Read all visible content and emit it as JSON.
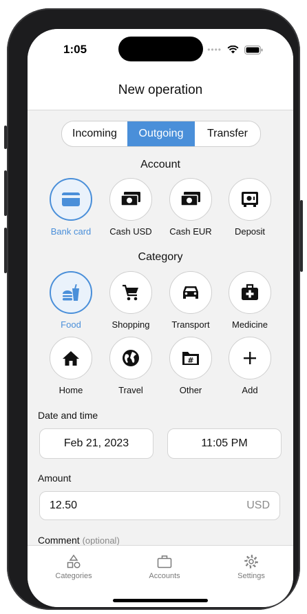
{
  "status": {
    "time": "1:05"
  },
  "nav": {
    "title": "New operation"
  },
  "type_tabs": [
    {
      "label": "Incoming"
    },
    {
      "label": "Outgoing"
    },
    {
      "label": "Transfer"
    }
  ],
  "selected_type": "Outgoing",
  "account": {
    "title": "Account",
    "items": [
      {
        "label": "Bank card",
        "icon": "credit-card-icon"
      },
      {
        "label": "Cash USD",
        "icon": "money-icon"
      },
      {
        "label": "Cash EUR",
        "icon": "money-icon"
      },
      {
        "label": "Deposit",
        "icon": "safe-icon"
      }
    ],
    "selected": "Bank card"
  },
  "category": {
    "title": "Category",
    "items": [
      {
        "label": "Food",
        "icon": "fastfood-icon"
      },
      {
        "label": "Shopping",
        "icon": "cart-icon"
      },
      {
        "label": "Transport",
        "icon": "car-icon"
      },
      {
        "label": "Medicine",
        "icon": "medical-bag-icon"
      },
      {
        "label": "Home",
        "icon": "home-icon"
      },
      {
        "label": "Travel",
        "icon": "globe-icon"
      },
      {
        "label": "Other",
        "icon": "folder-hash-icon"
      },
      {
        "label": "Add",
        "icon": "plus-icon"
      }
    ],
    "selected": "Food"
  },
  "datetime": {
    "label": "Date and time",
    "date": "Feb 21, 2023",
    "time": "11:05 PM"
  },
  "amount": {
    "label": "Amount",
    "value": "12.50",
    "currency": "USD"
  },
  "comment": {
    "label": "Comment",
    "optional": "(optional)"
  },
  "tabbar": [
    {
      "label": "Categories",
      "icon": "shapes-icon"
    },
    {
      "label": "Accounts",
      "icon": "briefcase-icon"
    },
    {
      "label": "Settings",
      "icon": "gear-icon"
    }
  ],
  "colors": {
    "accent": "#4a8fd9",
    "background": "#f2f2f2"
  }
}
